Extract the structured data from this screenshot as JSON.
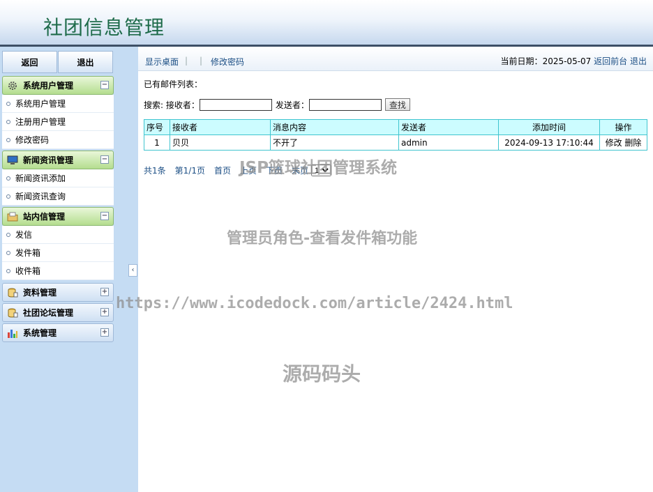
{
  "header": {
    "title": "社团信息管理"
  },
  "sidebar": {
    "buttons": [
      {
        "label": "返回"
      },
      {
        "label": "退出"
      }
    ],
    "groups": [
      {
        "title": "系统用户管理",
        "icon": "gear-icon",
        "expanded": true,
        "items": [
          "系统用户管理",
          "注册用户管理",
          "修改密码"
        ]
      },
      {
        "title": "新闻资讯管理",
        "icon": "monitor-icon",
        "expanded": true,
        "items": [
          "新闻资讯添加",
          "新闻资讯查询"
        ]
      },
      {
        "title": "站内信管理",
        "icon": "folder-icon",
        "expanded": true,
        "items": [
          "发信",
          "发件箱",
          "收件箱"
        ]
      },
      {
        "title": "资料管理",
        "icon": "database-icon",
        "expanded": false,
        "items": []
      },
      {
        "title": "社团论坛管理",
        "icon": "database-icon",
        "expanded": false,
        "items": []
      },
      {
        "title": "系统管理",
        "icon": "bar-chart-icon",
        "expanded": false,
        "items": []
      }
    ],
    "collapse_glyph": "‹"
  },
  "topbar": {
    "show_desktop": "显示桌面",
    "change_password": "修改密码",
    "date_label": "当前日期：",
    "date_value": "2025-05-07",
    "back_front": "返回前台",
    "logout": "退出"
  },
  "main": {
    "list_title": "已有邮件列表：",
    "search": {
      "label": "搜索: 接收者：",
      "receiver_value": "",
      "sender_label": "发送者：",
      "sender_value": "",
      "button": "查找"
    },
    "table": {
      "headers": [
        "序号",
        "接收者",
        "消息内容",
        "发送者",
        "添加时间",
        "操作"
      ],
      "rows": [
        {
          "no": "1",
          "receiver": "贝贝",
          "content": "不开了",
          "sender": "admin",
          "time": "2024-09-13 17:10:44",
          "edit": "修改",
          "delete": "删除"
        }
      ]
    },
    "pager": {
      "total": "共1条",
      "page": "第1/1页",
      "first": "首页",
      "prev": "上页",
      "next": "下页",
      "last": "末页",
      "selected": "1"
    }
  },
  "watermarks": {
    "system": "JSP篮球社团管理系统",
    "role": "管理员角色-查看发件箱功能",
    "url": "https://www.icodedock.com/article/2424.html",
    "brand": "源码码头"
  }
}
